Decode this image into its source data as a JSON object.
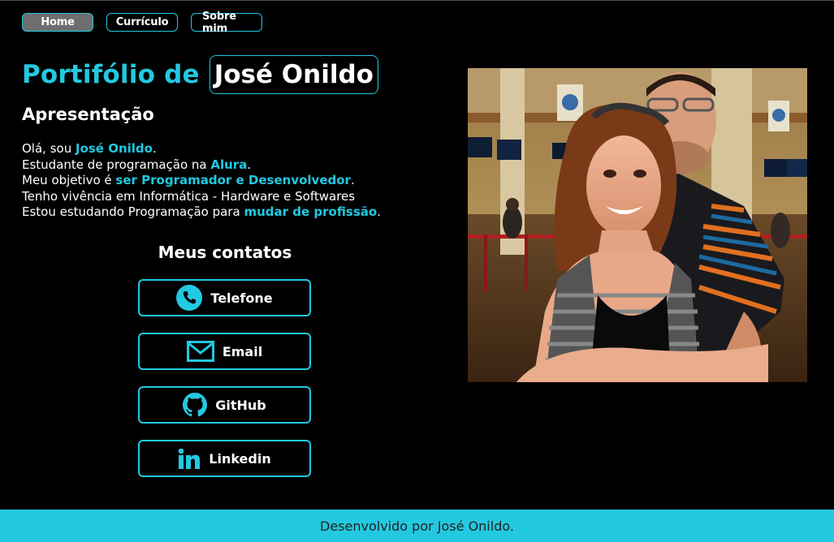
{
  "nav": {
    "home": "Home",
    "curriculo": "Currículo",
    "sobre": "Sobre mim"
  },
  "header": {
    "prefix": "Portifólio de",
    "name": "José Onildo"
  },
  "presentation": {
    "title": "Apresentação",
    "line1_a": "Olá, sou ",
    "line1_b": "José Onildo",
    "line1_c": ".",
    "line2_a": "Estudante de programação na ",
    "line2_b": "Alura",
    "line2_c": ".",
    "line3_a": "Meu objetivo é ",
    "line3_b": "ser Programador e Desenvolvedor",
    "line3_c": ".",
    "line4": "Tenho vivência em Informática - Hardware e Softwares",
    "line5_a": "Estou estudando Programação para ",
    "line5_b": "mudar de profissão",
    "line5_c": "."
  },
  "contacts": {
    "title": "Meus contatos",
    "items": [
      {
        "label": "Telefone",
        "icon": "phone-icon"
      },
      {
        "label": "Email",
        "icon": "email-icon"
      },
      {
        "label": "GitHub",
        "icon": "github-icon"
      },
      {
        "label": "Linkedin",
        "icon": "linkedin-icon"
      }
    ]
  },
  "footer": {
    "text": "Desenvolvido por José Onildo."
  },
  "colors": {
    "accent": "#22c9e0",
    "background": "#000000",
    "nav_active": "#6e6e6e"
  }
}
